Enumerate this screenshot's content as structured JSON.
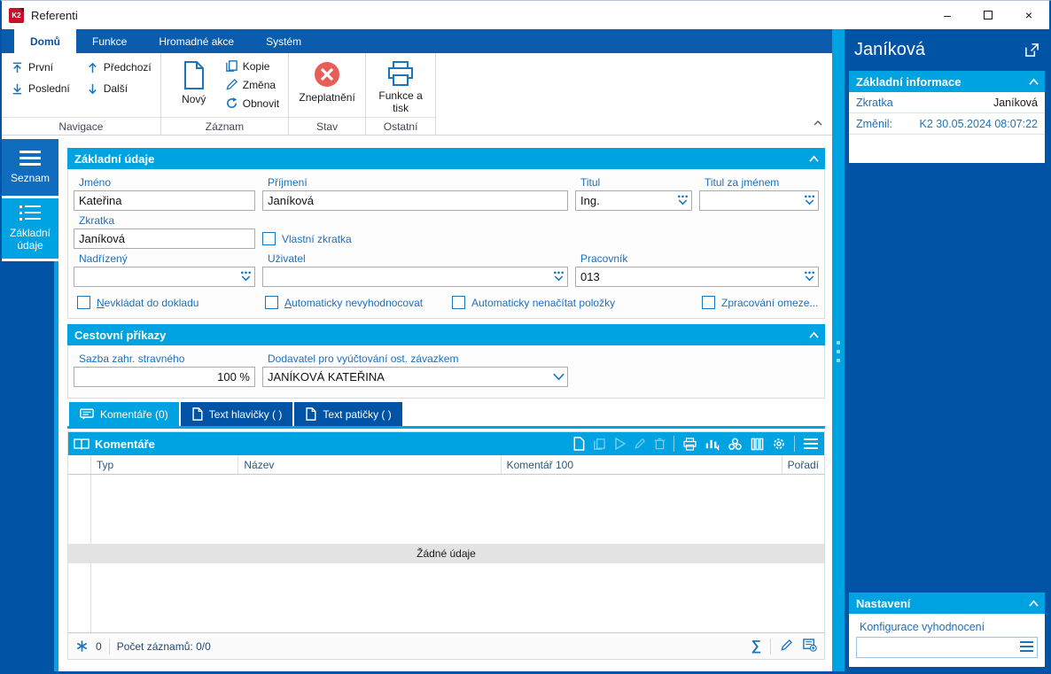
{
  "window": {
    "title": "Referenti",
    "logo_text": "K2",
    "controls": {
      "minimize": "–",
      "close": "×"
    }
  },
  "ribbon": {
    "tabs": [
      {
        "label": "Domů",
        "active": true
      },
      {
        "label": "Funkce",
        "active": false
      },
      {
        "label": "Hromadné akce",
        "active": false
      },
      {
        "label": "Systém",
        "active": false
      }
    ],
    "groups": [
      {
        "label": "Navigace",
        "buttons": [
          {
            "label": "První"
          },
          {
            "label": "Předchozí"
          },
          {
            "label": "Poslední"
          },
          {
            "label": "Další"
          }
        ]
      },
      {
        "label": "Záznam",
        "buttons": [
          {
            "label": "Nový"
          },
          {
            "label": "Kopie"
          },
          {
            "label": "Změna"
          },
          {
            "label": "Obnovit"
          }
        ]
      },
      {
        "label": "Stav",
        "buttons": [
          {
            "label": "Zneplatnění"
          }
        ]
      },
      {
        "label": "Ostatní",
        "buttons": [
          {
            "label": "Funkce a tisk"
          }
        ]
      }
    ]
  },
  "sidebar": {
    "items": [
      {
        "label": "Seznam",
        "active": false
      },
      {
        "label": "Základní údaje",
        "active": true
      }
    ]
  },
  "form": {
    "basic": {
      "title": "Základní údaje",
      "fields": {
        "jmeno": {
          "label": "Jméno",
          "value": "Kateřina"
        },
        "prijmeni": {
          "label": "Příjmení",
          "value": "Janíková"
        },
        "titul": {
          "label": "Titul",
          "value": "Ing."
        },
        "titul_za": {
          "label": "Titul za jménem",
          "value": ""
        },
        "zkratka": {
          "label": "Zkratka",
          "value": "Janíková"
        },
        "vlastni_zkratka": {
          "label": "Vlastní zkratka",
          "checked": false
        },
        "nadrizeny": {
          "label": "Nadřízený",
          "value": ""
        },
        "uzivatel": {
          "label": "Uživatel",
          "value": ""
        },
        "pracovnik": {
          "label": "Pracovník",
          "value": "013"
        }
      },
      "checkboxes": [
        {
          "label": "Nevkládat do dokladu",
          "checked": false
        },
        {
          "label": "Automaticky nevyhodnocovat",
          "checked": false
        },
        {
          "label": "Automaticky nenačítat položky",
          "checked": false
        },
        {
          "label": "Zpracování omeze...",
          "checked": false
        }
      ]
    },
    "travel": {
      "title": "Cestovní příkazy",
      "fields": {
        "sazba": {
          "label": "Sazba zahr. stravného",
          "value": "100 %"
        },
        "dodavatel": {
          "label": "Dodavatel pro vyúčtování ost. závazkem",
          "value": "JANÍKOVÁ KATEŘINA"
        }
      }
    },
    "tabs": [
      {
        "label": "Komentáře (0)",
        "active": true
      },
      {
        "label": "Text hlavičky ( )",
        "active": false
      },
      {
        "label": "Text patičky ( )",
        "active": false
      }
    ],
    "grid": {
      "title": "Komentáře",
      "columns": [
        "Typ",
        "Název",
        "Komentář 100",
        "Pořadí"
      ],
      "empty_text": "Žádné údaje",
      "footer": {
        "star_count": "0",
        "records": "Počet záznamů: 0/0",
        "sum_glyph": "∑"
      }
    }
  },
  "right_panel": {
    "title": "Janíková",
    "info": {
      "title": "Základní informace",
      "rows": [
        {
          "label": "Zkratka",
          "value": "Janíková"
        },
        {
          "label": "Změnil:",
          "value": "K2 30.05.2024 08:07:22"
        }
      ]
    },
    "settings": {
      "title": "Nastavení",
      "field_label": "Konfigurace vyhodnocení",
      "field_value": ""
    }
  },
  "colors": {
    "dark_blue": "#0053a5",
    "ribbon_blue": "#0b5cad",
    "accent_light_blue": "#00a3e2",
    "icon_blue": "#1b75bc",
    "invalid_red": "#e85d57"
  }
}
